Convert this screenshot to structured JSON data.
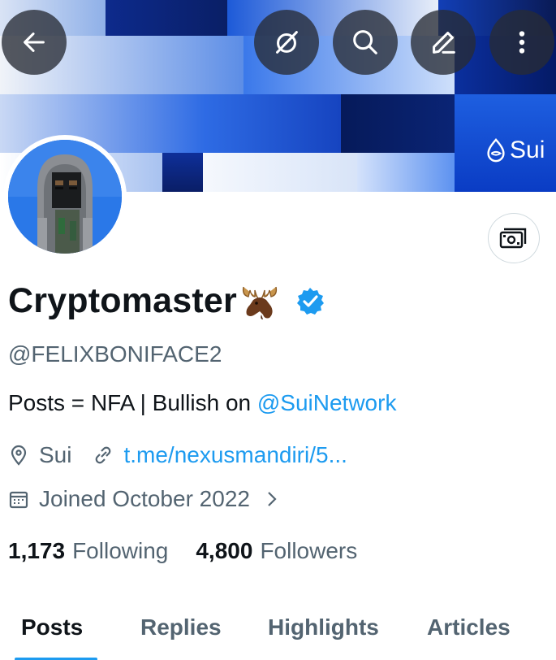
{
  "header": {
    "back_icon": "arrow-left-icon",
    "grok_icon": "grok-icon",
    "search_icon": "search-icon",
    "edit_icon": "pencil-icon",
    "more_icon": "more-vertical-icon",
    "banner_logo_text": "Sui"
  },
  "profile": {
    "display_name": "Cryptomaster",
    "name_emoji": "moose-emoji",
    "verified_badge": "verified-badge-icon",
    "handle": "@FELIXBONIFACE2",
    "bio_text": "Posts = NFA | Bullish on ",
    "bio_mention": "@SuiNetwork",
    "location": "Sui",
    "website": "t.me/nexusmandiri/5...",
    "joined": "Joined October 2022"
  },
  "stats": {
    "following_count": "1,173",
    "following_label": "Following",
    "followers_count": "4,800",
    "followers_label": "Followers"
  },
  "tabs": [
    {
      "label": "Posts",
      "active": true
    },
    {
      "label": "Replies",
      "active": false
    },
    {
      "label": "Highlights",
      "active": false
    },
    {
      "label": "Articles",
      "active": false
    }
  ],
  "colors": {
    "accent": "#1d9bf0",
    "text_primary": "#0f1419",
    "text_secondary": "#536471"
  }
}
